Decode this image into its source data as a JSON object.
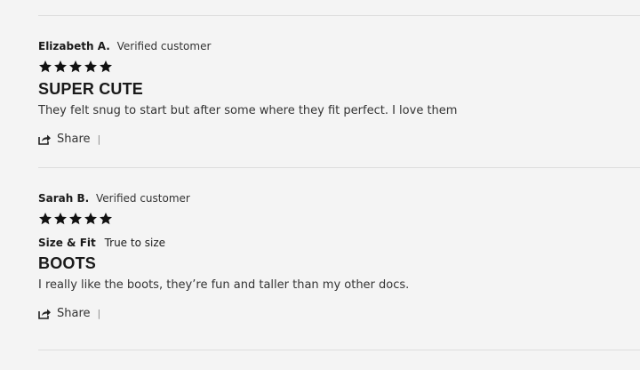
{
  "reviews": [
    {
      "author": "Elizabeth A.",
      "verified_label": "Verified customer",
      "rating": 5,
      "title": "SUPER CUTE",
      "body": "They felt snug to start but after some where they fit perfect. I love them",
      "share_label": "Share",
      "separator": "|"
    },
    {
      "author": "Sarah B.",
      "verified_label": "Verified customer",
      "rating": 5,
      "attribute_label": "Size & Fit",
      "attribute_value": "True to size",
      "title": "BOOTS",
      "body": "I really like the boots, they’re fun and taller than my other docs.",
      "share_label": "Share",
      "separator": "|"
    }
  ],
  "icons": {
    "star": "star-icon",
    "share": "share-icon"
  },
  "colors": {
    "background": "#f4f4f4",
    "text": "#1a1a1a",
    "divider": "#dddddd"
  }
}
